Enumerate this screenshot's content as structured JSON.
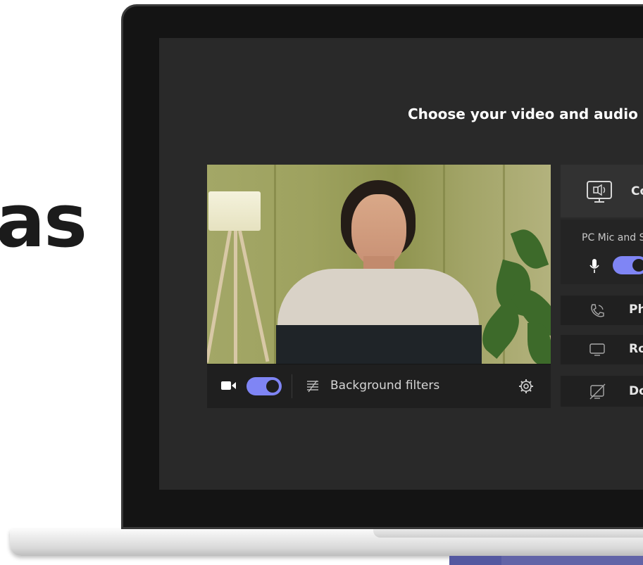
{
  "brand_text_fragment": "as",
  "screen_title": "Choose your video and audio o",
  "video_bar": {
    "camera_toggle_on": true,
    "background_filters_label": "Background filters"
  },
  "audio_options": {
    "computer_audio_label": "Co",
    "pc_mic_label": "PC Mic and S",
    "mic_toggle_on": true,
    "phone_audio_label": "Ph",
    "room_audio_label": "Ro",
    "dont_use_audio_label": "Do"
  },
  "colors": {
    "accent": "#7f85f5",
    "brand_bar": "#6264a7",
    "screen_bg": "#292929"
  }
}
